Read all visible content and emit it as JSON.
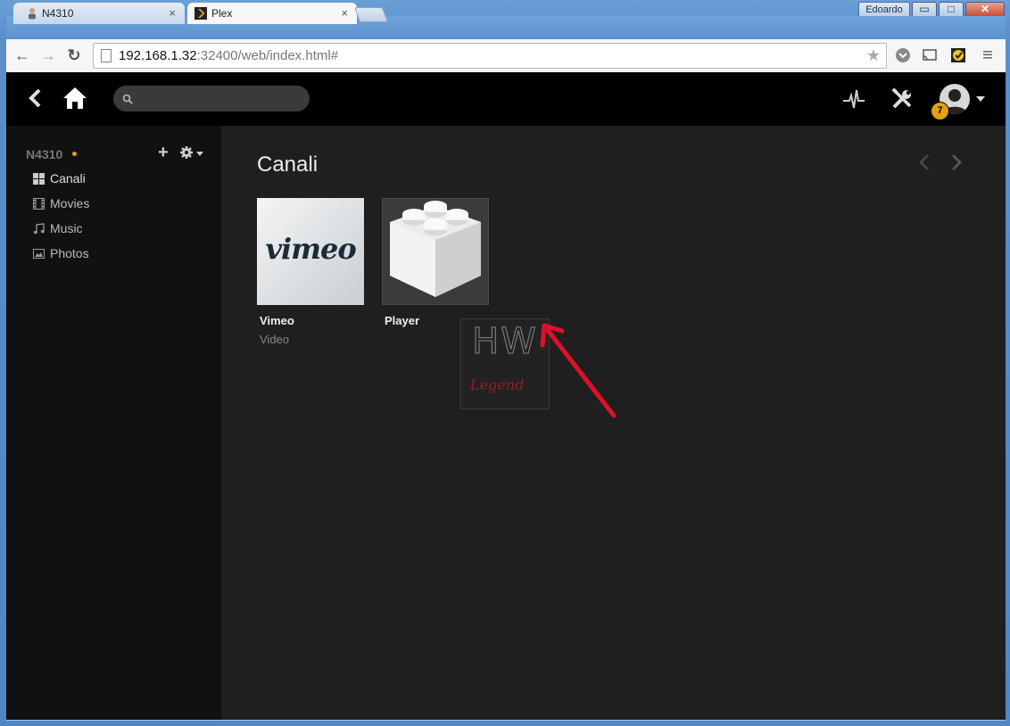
{
  "window": {
    "user_label": "Edoardo",
    "min_glyph": "▭",
    "max_glyph": "□",
    "close_glyph": "✕"
  },
  "tabs": [
    {
      "label": "N4310",
      "close": "×",
      "icon": "person-favicon-icon"
    },
    {
      "label": "Plex",
      "close": "×",
      "icon": "plex-favicon-icon"
    }
  ],
  "toolbar": {
    "url_host": "192.168.1.32",
    "url_rest": ":32400/web/index.html#",
    "back_glyph": "←",
    "forward_glyph": "→",
    "reload_glyph": "↻",
    "star_glyph": "★",
    "menu_glyph": "≡"
  },
  "plex": {
    "search_placeholder": "",
    "notifications_count": "7"
  },
  "sidebar": {
    "server_name": "N4310",
    "add_glyph": "+",
    "items": [
      {
        "label": "Canali",
        "icon": "grid-icon"
      },
      {
        "label": "Movies",
        "icon": "film-icon"
      },
      {
        "label": "Music",
        "icon": "music-note-icon"
      },
      {
        "label": "Photos",
        "icon": "picture-icon"
      }
    ]
  },
  "main": {
    "title": "Canali",
    "channels": [
      {
        "title": "Vimeo",
        "subtitle": "Video",
        "poster_text": "vimeo"
      },
      {
        "title": "Player",
        "subtitle": ""
      }
    ],
    "watermark": {
      "top": "HW",
      "bottom": "Legend"
    }
  },
  "colors": {
    "plex_accent": "#e5a00d",
    "sidebar_bg": "#111111",
    "main_bg": "#1f1f1f",
    "header_bg": "#000000",
    "annotation_arrow": "#e0102a"
  }
}
